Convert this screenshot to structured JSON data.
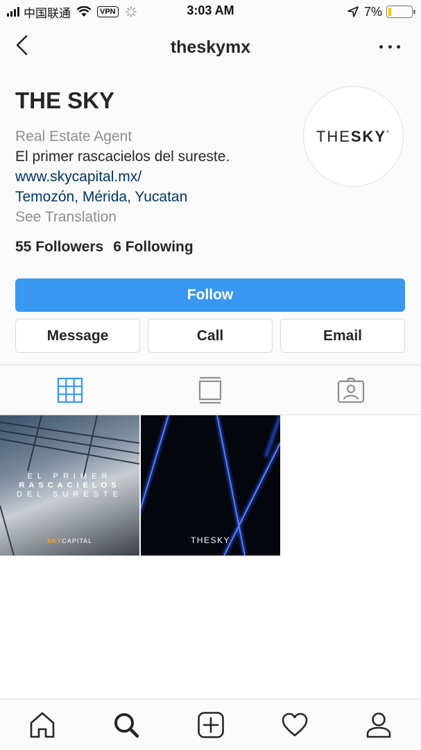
{
  "status_bar": {
    "carrier": "中国联通",
    "vpn": "VPN",
    "time": "3:03 AM",
    "battery_percent": "7%",
    "battery_level": 0.07
  },
  "nav": {
    "title": "theskymx",
    "back_icon": "chevron-left-icon",
    "more_icon": "more-horizontal-icon"
  },
  "profile": {
    "name": "THE SKY",
    "avatar_text_light": "THE",
    "avatar_text_bold": "SKY",
    "avatar_mark": "°",
    "category": "Real Estate Agent",
    "bio": "El primer rascacielos del sureste.",
    "website": "www.skycapital.mx/",
    "location": "Temozón, Mérida, Yucatan",
    "see_translation": "See Translation",
    "followers": "55 Followers",
    "following": "6 Following"
  },
  "buttons": {
    "follow": "Follow",
    "message": "Message",
    "call": "Call",
    "email": "Email"
  },
  "tabs": [
    {
      "icon": "grid-icon",
      "active": true
    },
    {
      "icon": "feed-list-icon",
      "active": false
    },
    {
      "icon": "tagged-photos-icon",
      "active": false
    }
  ],
  "posts": [
    {
      "line1": "EL PRIMER",
      "line2": "RASCACIELOS",
      "line3": "DEL SURESTE",
      "brand_a": "SKY",
      "brand_b": "CAPITAL"
    },
    {
      "brand": "THESKY"
    }
  ],
  "bottom_nav": [
    {
      "icon": "home-icon"
    },
    {
      "icon": "search-icon",
      "active": true
    },
    {
      "icon": "add-post-icon"
    },
    {
      "icon": "heart-icon"
    },
    {
      "icon": "profile-icon"
    }
  ],
  "colors": {
    "accent": "#3897f0",
    "link": "#003569",
    "muted": "#8e8e8e",
    "battery": "#f5c400"
  }
}
